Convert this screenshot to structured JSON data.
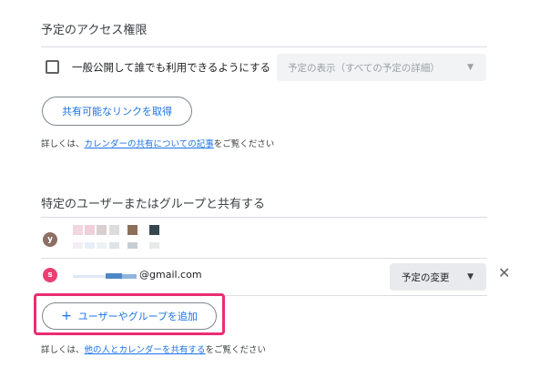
{
  "access": {
    "heading": "予定のアクセス権限",
    "public_checkbox_label": "一般公開して誰でも利用できるようにする",
    "visibility_select_value": "予定の表示（すべての予定の詳細）",
    "get_link_button": "共有可能なリンクを取得",
    "help_prefix": "詳しくは、",
    "help_link": "カレンダーの共有についての記事",
    "help_suffix": "をご覧ください"
  },
  "share": {
    "heading": "特定のユーザーまたはグループと共有する",
    "users": [
      {
        "avatar_letter": "y",
        "avatar_color": "#8d6e63",
        "email": ""
      },
      {
        "avatar_letter": "s",
        "avatar_color": "#e84072",
        "email_suffix": "@gmail.com",
        "permission": "予定の変更"
      }
    ],
    "add_button": "ユーザーやグループを追加",
    "add_icon": "+",
    "help_prefix": "詳しくは、",
    "help_link": "他の人とカレンダーを共有する",
    "help_suffix": "をご覧ください"
  },
  "colors": {
    "accent": "#1a73e8",
    "highlight": "#ea2d73"
  }
}
